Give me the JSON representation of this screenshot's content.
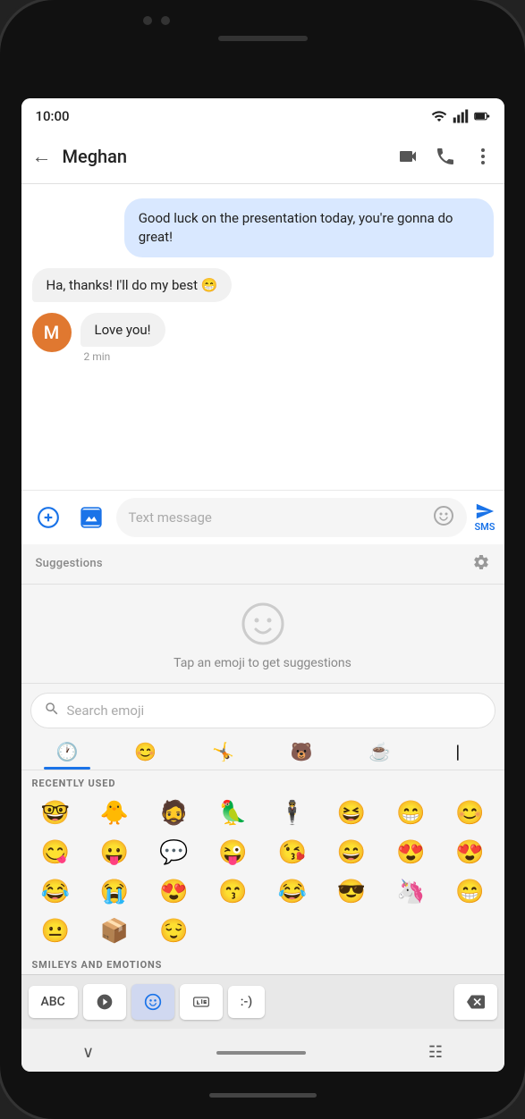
{
  "phone": {
    "status_time": "10:00",
    "contact_name": "Meghan"
  },
  "messages": [
    {
      "id": "msg1",
      "type": "outgoing",
      "text": "Good luck on the presentation today, you're gonna do great!"
    },
    {
      "id": "msg2",
      "type": "incoming",
      "text": "Ha, thanks! I'll do my best 😁"
    },
    {
      "id": "msg3",
      "type": "incoming",
      "text": "Love you!"
    }
  ],
  "message_time": "2 min",
  "avatar_letter": "M",
  "input": {
    "placeholder": "Text message",
    "sms_label": "SMS"
  },
  "suggestions": {
    "label": "Suggestions",
    "tap_hint": "Tap an emoji to get suggestions"
  },
  "emoji_search": {
    "placeholder": "Search emoji"
  },
  "emoji_sections": {
    "recently_used_label": "RECENTLY USED",
    "smileys_label": "SMILEYS AND EMOTIONS",
    "recently_used": [
      "🤓",
      "🐥",
      "🧔",
      "🦜",
      "🕴",
      "😆",
      "😁",
      "😊",
      "😋",
      "😛",
      "💬",
      "😜",
      "😘",
      "😄",
      "😍",
      "😍",
      "😂",
      "😭",
      "😍",
      "😙",
      "😂",
      "😎",
      "🦄",
      "😁",
      "😐",
      "📦",
      "😌"
    ],
    "categories": [
      "🕐",
      "😊",
      "🤸",
      "🐻",
      "☕"
    ]
  },
  "keyboard_bottom": {
    "abc_label": "ABC",
    "gif_label": "GIF",
    "text_emoticon": ":-)"
  }
}
